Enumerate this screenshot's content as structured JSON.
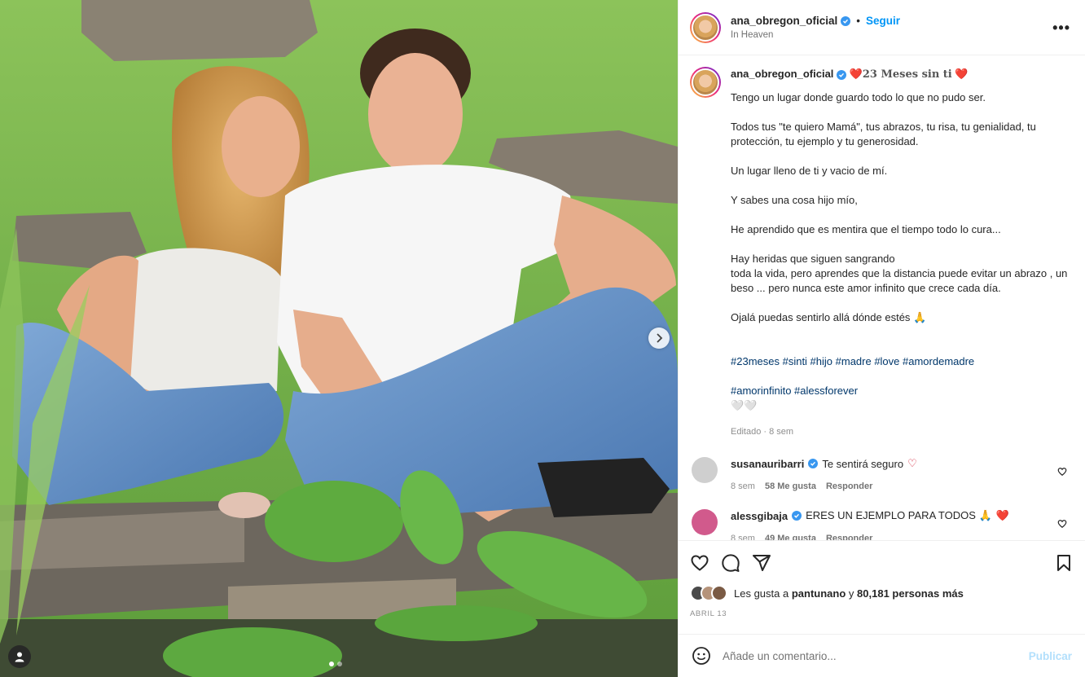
{
  "post": {
    "username": "ana_obregon_oficial",
    "follow_label": "Seguir",
    "separator": "•",
    "location": "In Heaven",
    "more_label": "•••",
    "carousel": {
      "total": 2,
      "active": 0
    }
  },
  "caption": {
    "username": "ana_obregon_oficial",
    "title_prefix": "❤️",
    "title": "23 Meses sin ti",
    "title_suffix": "❤️",
    "paragraphs": [
      "Tengo un lugar donde guardo todo lo que no pudo ser.",
      "Todos tus \"te quiero Mamá\", tus abrazos, tu risa, tu genialidad, tu protección, tu ejemplo y tu generosidad.",
      "Un lugar lleno de ti y vacio de mí.",
      "Y sabes una cosa hijo mío,",
      "He aprendido que es mentira que el tiempo todo lo cura...",
      "Hay heridas que siguen sangrando\ntoda la vida, pero aprendes que la distancia puede evitar un abrazo , un beso ... pero nunca este amor infinito que crece cada día.",
      "Ojalá puedas sentirlo allá dónde estés 🙏"
    ],
    "hashtags_line1": "#23meses #sinti #hijo #madre #love #amordemadre",
    "hashtags_line2": "#amorinfinito #alessforever",
    "hashtags_suffix": "🤍🤍",
    "edited": "Editado · 8 sem"
  },
  "comments": [
    {
      "username": "susanauribarri",
      "text": "Te sentirá seguro",
      "text_suffix": "♡",
      "age": "8 sem",
      "likes": "58 Me gusta",
      "reply": "Responder",
      "avatar_color": "#cfcfcf"
    },
    {
      "username": "alessgibaja",
      "text": "ERES UN EJEMPLO PARA TODOS 🙏",
      "text_suffix": "❤️",
      "age": "8 sem",
      "likes": "49 Me gusta",
      "reply": "Responder",
      "avatar_color": "#d15a8c"
    }
  ],
  "actions": {
    "likes_prefix": "Les gusta a",
    "liked_by": "pantunano",
    "likes_joiner": "y",
    "likes_count": "80,181 personas más",
    "date": "ABRIL 13"
  },
  "comment_box": {
    "placeholder": "Añade un comentario...",
    "publish": "Publicar"
  },
  "colors": {
    "link_blue": "#0095f6",
    "hashtag": "#00376b",
    "verified": "#3897f0",
    "muted": "#8e8e8e"
  }
}
